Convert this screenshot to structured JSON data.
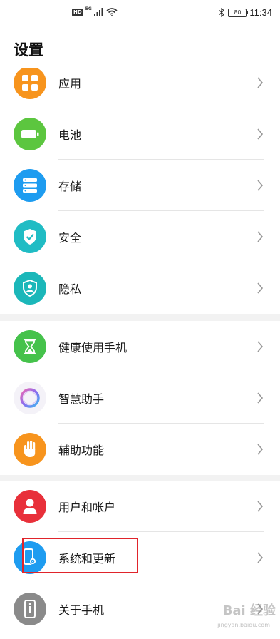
{
  "status_bar": {
    "badge_hd": "HD",
    "network": "5G",
    "battery": "80",
    "time": "11:34"
  },
  "header": {
    "title": "设置"
  },
  "groups": [
    {
      "items": [
        {
          "label": "应用",
          "icon": "apps-grid-icon",
          "color": "#f7941d"
        },
        {
          "label": "电池",
          "icon": "battery-icon",
          "color": "#5cc63f"
        },
        {
          "label": "存储",
          "icon": "storage-icon",
          "color": "#1e9cf0"
        },
        {
          "label": "安全",
          "icon": "shield-check-icon",
          "color": "#20bcc4"
        },
        {
          "label": "隐私",
          "icon": "privacy-shield-icon",
          "color": "#1bb7b9"
        }
      ]
    },
    {
      "items": [
        {
          "label": "健康使用手机",
          "icon": "hourglass-icon",
          "color": "#45c24b"
        },
        {
          "label": "智慧助手",
          "icon": "assistant-ring-icon",
          "color": "#ffffff"
        },
        {
          "label": "辅助功能",
          "icon": "hand-icon",
          "color": "#f7941d"
        }
      ]
    },
    {
      "items": [
        {
          "label": "用户和帐户",
          "icon": "user-icon",
          "color": "#e8303a"
        },
        {
          "label": "系统和更新",
          "icon": "phone-settings-icon",
          "color": "#1e9cf0"
        },
        {
          "label": "关于手机",
          "icon": "phone-info-icon",
          "color": "#8a8a8a"
        }
      ]
    }
  ],
  "watermark": {
    "text": "Bai 经验",
    "sub": "jingyan.baidu.com"
  }
}
